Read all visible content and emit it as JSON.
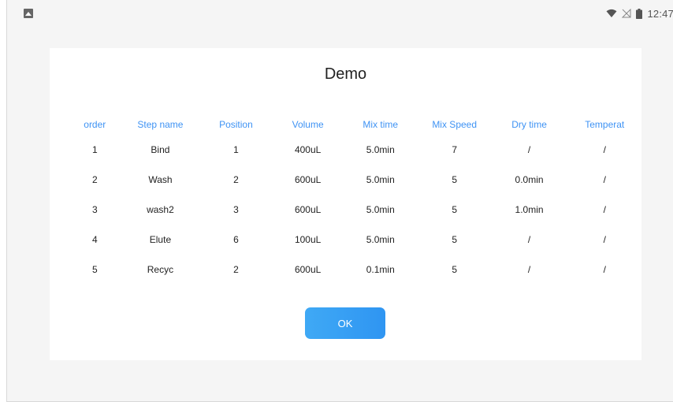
{
  "status_bar": {
    "left_icon": "gallery-icon",
    "time": "12:47",
    "icons": [
      "wifi-icon",
      "no-signal-icon",
      "battery-icon"
    ]
  },
  "dialog": {
    "title": "Demo",
    "columns": [
      "order",
      "Step name",
      "Position",
      "Volume",
      "Mix time",
      "Mix Speed",
      "Dry time",
      "Temperat"
    ],
    "rows": [
      [
        "1",
        "Bind",
        "1",
        "400uL",
        "5.0min",
        "7",
        "/",
        "/"
      ],
      [
        "2",
        "Wash",
        "2",
        "600uL",
        "5.0min",
        "5",
        "0.0min",
        "/"
      ],
      [
        "3",
        "wash2",
        "3",
        "600uL",
        "5.0min",
        "5",
        "1.0min",
        "/"
      ],
      [
        "4",
        "Elute",
        "6",
        "100uL",
        "5.0min",
        "5",
        "/",
        "/"
      ],
      [
        "5",
        "Recyc",
        "2",
        "600uL",
        "0.1min",
        "5",
        "/",
        "/"
      ]
    ],
    "ok_label": "OK"
  },
  "colors": {
    "header_text": "#3f93f4",
    "button": "#3fa9f5",
    "background": "#f5f5f5"
  }
}
